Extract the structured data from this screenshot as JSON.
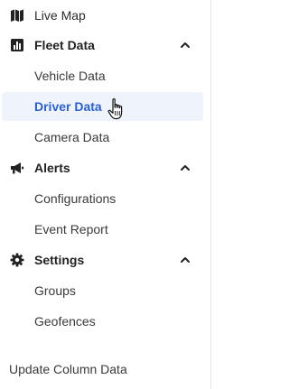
{
  "sidebar": {
    "live_map": {
      "label": "Live Map",
      "icon": "map-icon"
    },
    "fleet_data": {
      "label": "Fleet Data",
      "icon": "bar-chart-icon",
      "expanded": true,
      "items": [
        "Vehicle Data",
        "Driver Data",
        "Camera Data"
      ],
      "active_item": "Driver Data"
    },
    "alerts": {
      "label": "Alerts",
      "icon": "megaphone-icon",
      "expanded": true,
      "items": [
        "Configurations",
        "Event Report"
      ]
    },
    "settings": {
      "label": "Settings",
      "icon": "gear-icon",
      "expanded": true,
      "items": [
        "Groups",
        "Geofences"
      ]
    },
    "footer": {
      "label": "Update Column Data"
    }
  },
  "colors": {
    "accent": "#2c62c6",
    "active_bg": "#eef3fc",
    "text": "#2b2b2b"
  }
}
